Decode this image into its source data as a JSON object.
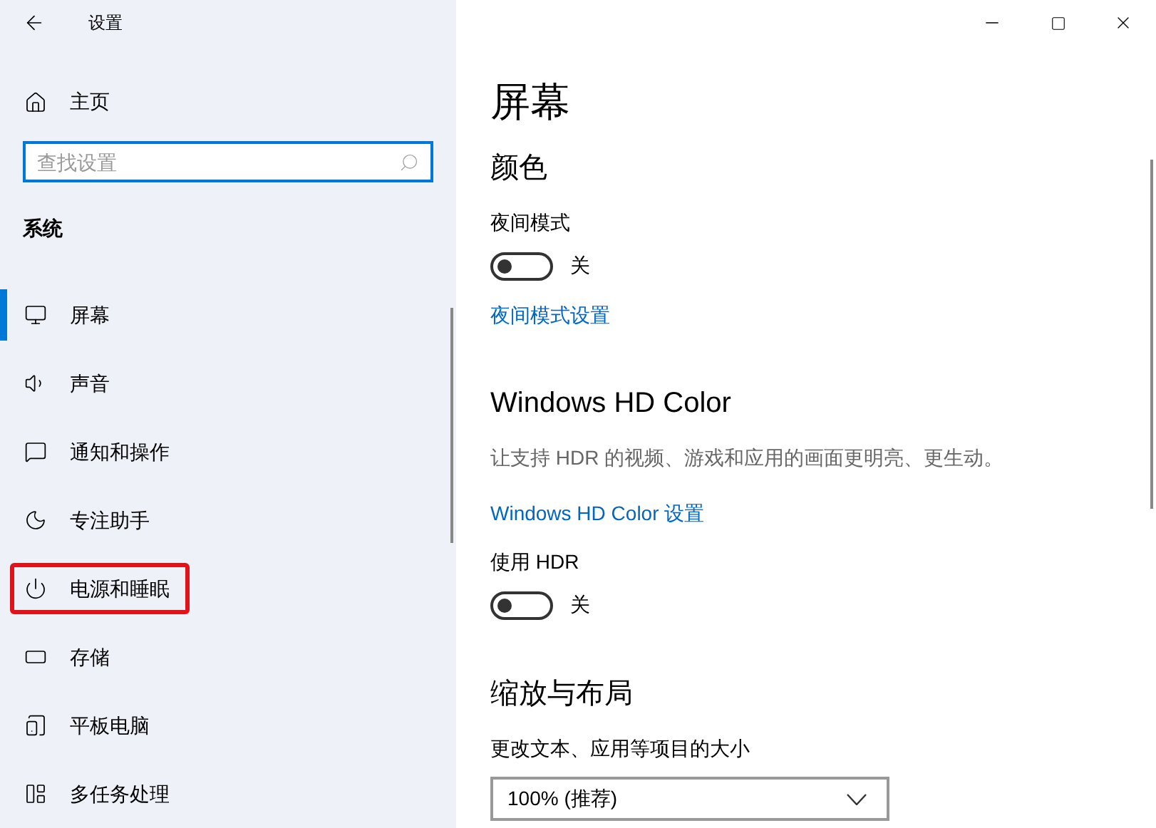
{
  "window": {
    "title": "设置"
  },
  "sidebar": {
    "home": "主页",
    "search": {
      "placeholder": "查找设置"
    },
    "section": "系统",
    "items": [
      {
        "label": "屏幕",
        "selected": true,
        "highlighted": false
      },
      {
        "label": "声音",
        "selected": false,
        "highlighted": false
      },
      {
        "label": "通知和操作",
        "selected": false,
        "highlighted": false
      },
      {
        "label": "专注助手",
        "selected": false,
        "highlighted": false
      },
      {
        "label": "电源和睡眠",
        "selected": false,
        "highlighted": true
      },
      {
        "label": "存储",
        "selected": false,
        "highlighted": false
      },
      {
        "label": "平板电脑",
        "selected": false,
        "highlighted": false
      },
      {
        "label": "多任务处理",
        "selected": false,
        "highlighted": false
      }
    ]
  },
  "main": {
    "title": "屏幕",
    "sections": [
      {
        "heading": "颜色",
        "items": [
          {
            "kind": "toggle",
            "label": "夜间模式",
            "on": false,
            "state": "关"
          },
          {
            "kind": "link",
            "text": "夜间模式设置"
          }
        ]
      },
      {
        "heading": "Windows HD Color",
        "items": [
          {
            "kind": "text",
            "text": "让支持 HDR 的视频、游戏和应用的画面更明亮、更生动。"
          },
          {
            "kind": "link",
            "text": "Windows HD Color 设置"
          },
          {
            "kind": "toggle",
            "label": "使用 HDR",
            "on": false,
            "state": "关"
          }
        ]
      },
      {
        "heading": "缩放与布局",
        "items": [
          {
            "kind": "dropdown",
            "label": "更改文本、应用等项目的大小",
            "value": "100% (推荐)"
          }
        ]
      }
    ]
  }
}
